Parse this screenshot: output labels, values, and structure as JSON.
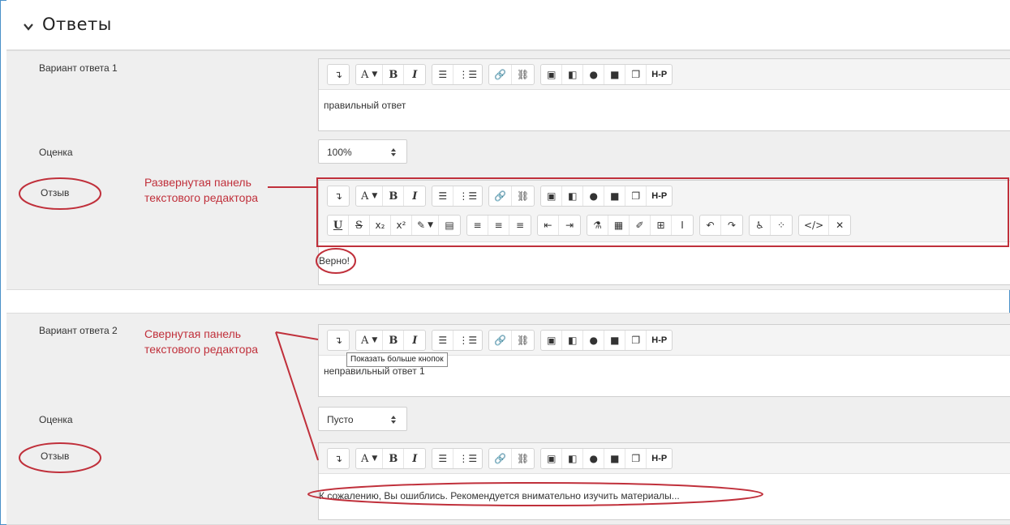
{
  "section": {
    "title": "Ответы",
    "chevron_icon": "chevron-down-icon"
  },
  "answer1": {
    "label": "Вариант ответа 1",
    "text": "правильный ответ",
    "grade_label": "Оценка",
    "grade_value": "100%",
    "feedback_label": "Отзыв",
    "feedback_text": "Верно!"
  },
  "answer2": {
    "label": "Вариант ответа 2",
    "text": "неправильный ответ 1",
    "grade_label": "Оценка",
    "grade_value": "Пусто",
    "feedback_label": "Отзыв",
    "feedback_text": "К сожалению, Вы ошиблись. Рекомендуется внимательно изучить материалы..."
  },
  "toolbar": {
    "bold": "B",
    "italic": "I",
    "font_a": "A",
    "h5p": "H-P",
    "underline": "U",
    "strike": "S",
    "subscript": "x₂",
    "superscript": "x²",
    "tooltip": "Показать больше кнопок"
  },
  "annotations": {
    "expanded_line1": "Развернутая панель",
    "expanded_line2": "текстового редактора",
    "collapsed_line1": "Свернутая панель",
    "collapsed_line2": "текстового редактора"
  },
  "colors": {
    "annotation": "#c0303b",
    "frame": "#4a90c8",
    "row_background": "#efefef"
  }
}
